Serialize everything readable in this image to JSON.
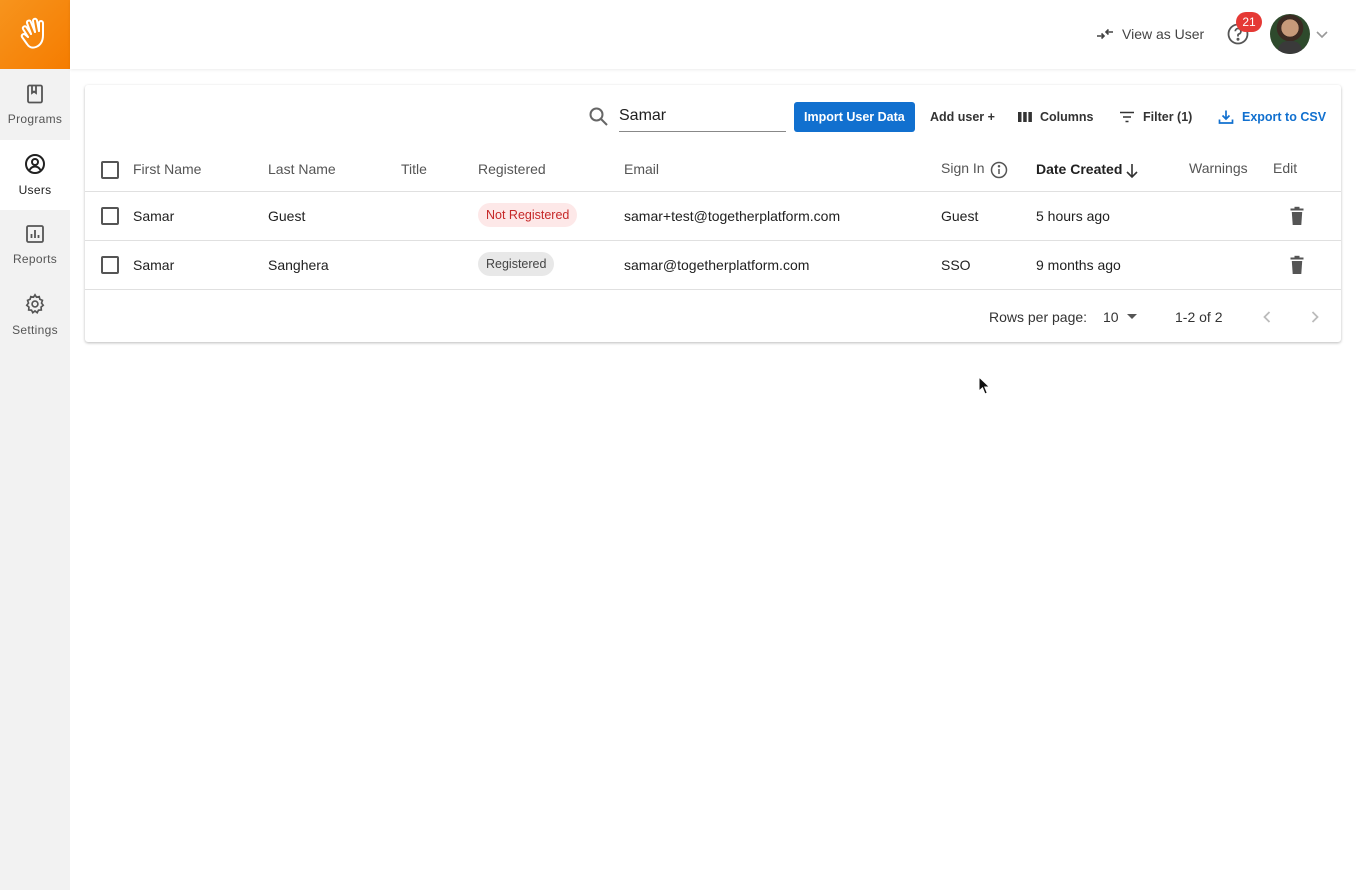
{
  "sidebar": {
    "items": [
      {
        "label": "Programs",
        "icon": "book-icon"
      },
      {
        "label": "Users",
        "icon": "user-circle-icon"
      },
      {
        "label": "Reports",
        "icon": "bar-chart-icon"
      },
      {
        "label": "Settings",
        "icon": "gear-icon"
      }
    ],
    "active": "Users"
  },
  "header": {
    "view_as_user": "View as User",
    "help_badge": "21"
  },
  "toolbar": {
    "search_value": "Samar",
    "import_label": "Import User Data",
    "add_user_label": "Add user +",
    "columns_label": "Columns",
    "filter_label": "Filter (1)",
    "export_label": "Export to CSV"
  },
  "table": {
    "columns": [
      "First Name",
      "Last Name",
      "Title",
      "Registered",
      "Email",
      "Sign In",
      "Date Created",
      "Warnings",
      "Edit"
    ],
    "sorted_column": "Date Created",
    "rows": [
      {
        "first": "Samar",
        "last": "Guest",
        "title": "",
        "registered": "Not Registered",
        "email": "samar+test@togetherplatform.com",
        "sign_in": "Guest",
        "date_created": "5 hours ago",
        "warnings": ""
      },
      {
        "first": "Samar",
        "last": "Sanghera",
        "title": "",
        "registered": "Registered",
        "email": "samar@togetherplatform.com",
        "sign_in": "SSO",
        "date_created": "9 months ago",
        "warnings": ""
      }
    ]
  },
  "pagination": {
    "rows_per_page_label": "Rows per page:",
    "rows_per_page": "10",
    "range": "1-2 of 2"
  },
  "colors": {
    "brand_orange": "#f57c00",
    "primary_blue": "#1170cf",
    "badge_red": "#e53935"
  }
}
